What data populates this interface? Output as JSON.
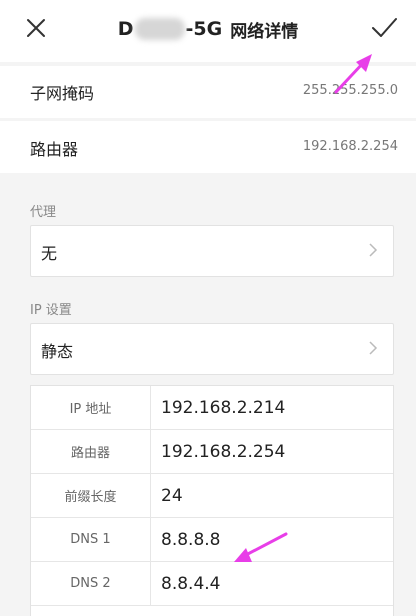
{
  "header": {
    "title_prefix": "D",
    "title_suffix": "-5G",
    "title_label": "网络详情",
    "close_icon": "close-icon",
    "confirm_icon": "checkmark-icon"
  },
  "network_info": [
    {
      "label": "子网掩码",
      "value": "255.255.255.0"
    },
    {
      "label": "路由器",
      "value": "192.168.2.254"
    }
  ],
  "proxy": {
    "section_label": "代理",
    "value": "无"
  },
  "ip_settings": {
    "section_label": "IP 设置",
    "value": "静态",
    "rows": [
      {
        "key": "IP 地址",
        "value": "192.168.2.214"
      },
      {
        "key": "路由器",
        "value": "192.168.2.254"
      },
      {
        "key": "前缀长度",
        "value": "24"
      },
      {
        "key": "DNS 1",
        "value": "8.8.8.8"
      },
      {
        "key": "DNS 2",
        "value": "8.8.4.4"
      }
    ]
  },
  "colors": {
    "annotation_arrow": "#e83ee8",
    "background": "#f4f4f4"
  }
}
